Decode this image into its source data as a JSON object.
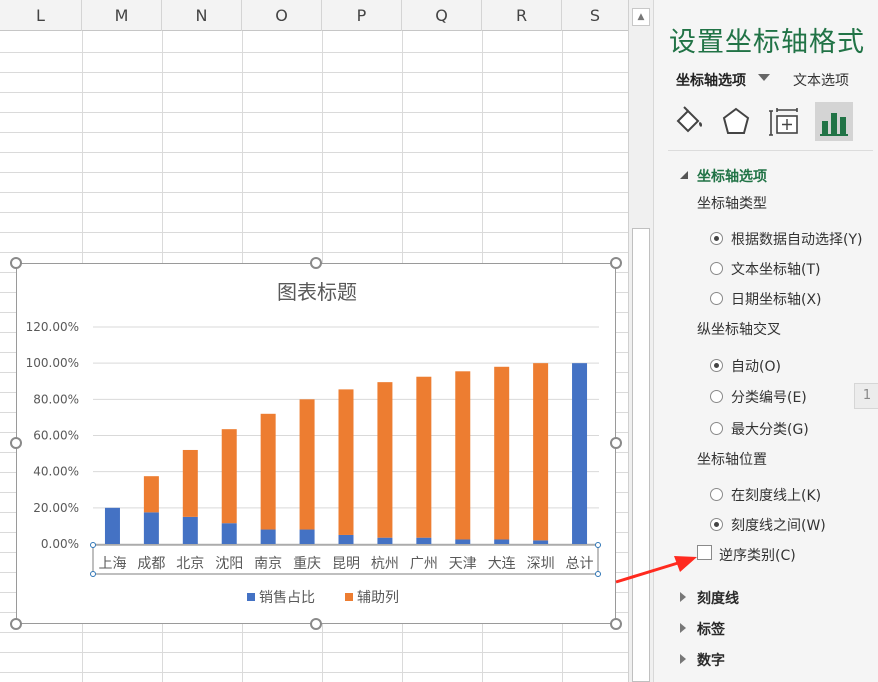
{
  "sheet": {
    "columns": [
      "L",
      "M",
      "N",
      "O",
      "P",
      "Q",
      "R",
      "S"
    ]
  },
  "chart": {
    "title": "图表标题",
    "legend": [
      {
        "name": "销售占比",
        "color": "#4472c4"
      },
      {
        "name": "辅助列",
        "color": "#ed7d31"
      }
    ]
  },
  "chart_data": {
    "type": "bar",
    "stacked": true,
    "title": "图表标题",
    "categories": [
      "上海",
      "成都",
      "北京",
      "沈阳",
      "南京",
      "重庆",
      "昆明",
      "杭州",
      "广州",
      "天津",
      "大连",
      "深圳",
      "总计"
    ],
    "series": [
      {
        "name": "销售占比",
        "color": "#4472c4",
        "values": [
          20,
          17.5,
          15,
          11.5,
          8,
          8,
          5,
          3.5,
          3.5,
          2.5,
          2.5,
          2,
          100
        ]
      },
      {
        "name": "辅助列",
        "color": "#ed7d31",
        "values": [
          0,
          20,
          37,
          52,
          64,
          72,
          80.5,
          86,
          89,
          93,
          95.5,
          98,
          0
        ]
      }
    ],
    "yticks": [
      "0.00%",
      "20.00%",
      "40.00%",
      "60.00%",
      "80.00%",
      "100.00%",
      "120.00%"
    ],
    "ylim": [
      0,
      120
    ],
    "ytick_step": 20,
    "grid": true,
    "legend_position": "bottom"
  },
  "pane": {
    "title": "设置坐标轴格式",
    "tab_axis_options": "坐标轴选项",
    "tab_text_options": "文本选项",
    "section_axis_options": "坐标轴选项",
    "axis_type_label": "坐标轴类型",
    "axis_type_options": [
      "根据数据自动选择(Y)",
      "文本坐标轴(T)",
      "日期坐标轴(X)"
    ],
    "axis_type_selected": 0,
    "vertical_cross_label": "纵坐标轴交叉",
    "vertical_cross_options": [
      "自动(O)",
      "分类编号(E)",
      "最大分类(G)"
    ],
    "vertical_cross_selected": 0,
    "side_number": "1",
    "axis_position_label": "坐标轴位置",
    "axis_position_options": [
      "在刻度线上(K)",
      "刻度线之间(W)"
    ],
    "axis_position_selected": 1,
    "reverse_label": "逆序类别(C)",
    "reverse_checked": false,
    "section_tick_marks": "刻度线",
    "section_labels": "标签",
    "section_number": "数字"
  },
  "colors": {
    "accent": "#217346",
    "annotation_arrow": "#ff2a1f"
  }
}
